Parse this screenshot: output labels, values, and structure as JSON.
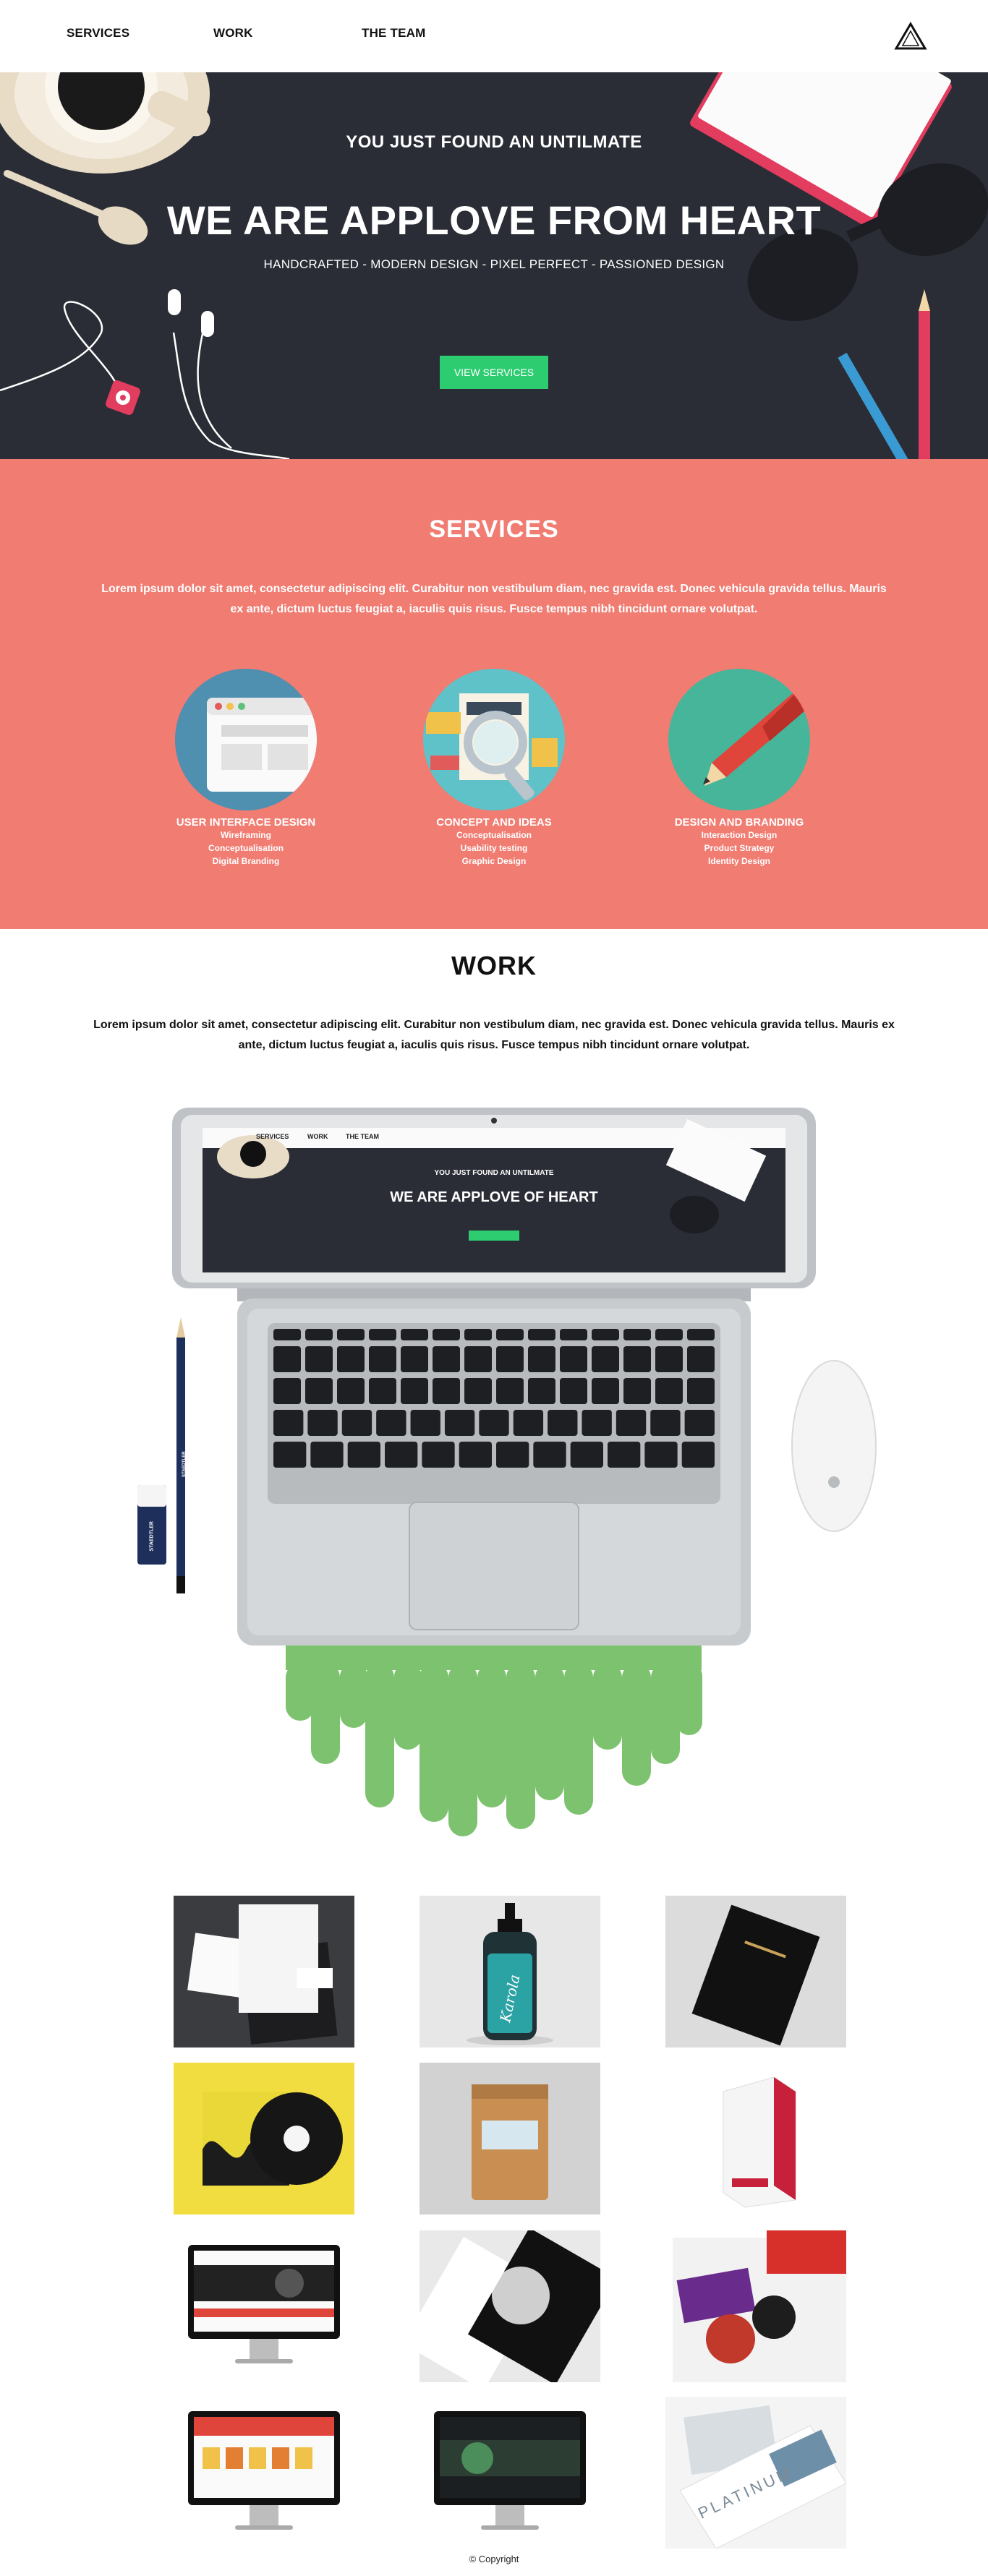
{
  "nav": {
    "links": [
      "SERVICES",
      "WORK",
      "THE TEAM"
    ],
    "logo_icon": "triangle-logo-icon"
  },
  "hero": {
    "kicker": "YOU JUST FOUND AN UNTILMATE",
    "title": "WE ARE APPLOVE FROM HEART",
    "subtitle": "HANDCRAFTED - MODERN DESIGN - PIXEL PERFECT - PASSIONED DESIGN",
    "cta_label": "VIEW SERVICES",
    "background": "#2a2d35",
    "cta_color": "#2ecc71"
  },
  "services": {
    "title": "SERVICES",
    "lorem": "Lorem ipsum dolor sit amet, consectetur adipiscing elit. Curabitur non vestibulum diam, nec gravida est. Donec vehicula gravida tellus. Mauris ex ante, dictum luctus feugiat a, iaculis quis risus. Fusce tempus nibh tincidunt ornare volutpat.",
    "background": "#f07c72",
    "items": [
      {
        "title": "USER INTERFACE DESIGN",
        "lines": [
          "Wireframing",
          "Conceptualisation",
          "Digital Branding"
        ],
        "icon": "browser-window-icon"
      },
      {
        "title": "CONCEPT AND IDEAS",
        "lines": [
          "Conceptualisation",
          "Usability testing",
          "Graphic Design"
        ],
        "icon": "magnifier-icon"
      },
      {
        "title": "DESIGN AND BRANDING",
        "lines": [
          "Interaction Design",
          "Product Strategy",
          "Identity Design"
        ],
        "icon": "pencil-icon"
      }
    ]
  },
  "work": {
    "title": "WORK",
    "lorem": "Lorem ipsum dolor sit amet, consectetur adipiscing elit. Curabitur non vestibulum diam, nec gravida est. Donec vehicula gravida tellus. Mauris ex ante, dictum luctus feugiat a, iaculis quis risus. Fusce tempus nibh tincidunt ornare volutpat.",
    "laptop_screen": {
      "nav": [
        "SERVICES",
        "WORK",
        "THE TEAM"
      ],
      "kicker": "YOU JUST FOUND AN UNTILMATE",
      "title": "WE ARE APPLOVE OF HEART"
    },
    "pencil_brand": "STAEDTLER",
    "eraser_brand": "STAEDTLER",
    "drip_color": "#7dc26f",
    "portfolio": [
      {
        "name": "stationery-mockup"
      },
      {
        "name": "bottle-mockup",
        "label": "Karola"
      },
      {
        "name": "book-mockup"
      },
      {
        "name": "vinyl-mockup"
      },
      {
        "name": "coffee-bag-mockup"
      },
      {
        "name": "box-mockup"
      },
      {
        "name": "website-mockup-1"
      },
      {
        "name": "brand-identity-mockup"
      },
      {
        "name": "brochure-mockup"
      },
      {
        "name": "website-mockup-2"
      },
      {
        "name": "website-mockup-3"
      },
      {
        "name": "platinum-brochure-mockup",
        "label": "PLATINUM"
      }
    ]
  },
  "footer": {
    "copyright": "© Copyright"
  }
}
